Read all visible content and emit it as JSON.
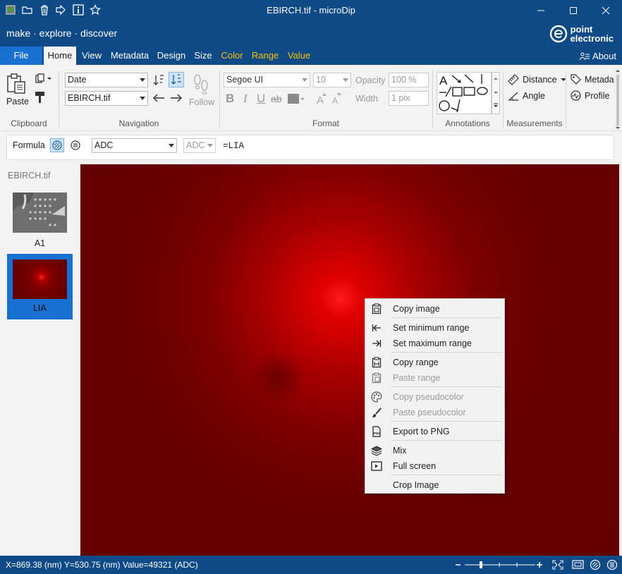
{
  "window": {
    "title": "EBIRCH.tif - microDip",
    "tagline": "make · explore · discover",
    "logo": {
      "line1": "point",
      "line2": "electronic"
    }
  },
  "menu": {
    "file": "File",
    "tabs": [
      "Home",
      "View",
      "Metadata",
      "Design",
      "Size",
      "Color",
      "Range",
      "Value"
    ],
    "about": "About"
  },
  "ribbon": {
    "clipboard": {
      "paste": "Paste",
      "label": "Clipboard"
    },
    "navigation": {
      "sort_select": "Date",
      "file_select": "EBIRCH.tif",
      "follow": "Follow",
      "label": "Navigation"
    },
    "format": {
      "font": "Segoe UI",
      "size": "10",
      "opacity_label": "Opacity",
      "opacity_value": "100 %",
      "width_label": "Width",
      "width_value": "1 pix",
      "bold": "B",
      "italic": "I",
      "underline": "U",
      "strike": "ab",
      "label": "Format"
    },
    "annotations": {
      "label": "Annotations",
      "text_tool": "A"
    },
    "measurements": {
      "distance": "Distance",
      "angle": "Angle",
      "label": "Measurements"
    },
    "extra": {
      "metadata": "Metada",
      "profile": "Profile"
    }
  },
  "formula": {
    "label": "Formula",
    "channel": "ADC",
    "unit": "ADC",
    "expression": "=LIA"
  },
  "panel": {
    "file": "EBIRCH.tif",
    "thumbnails": [
      {
        "label": "A1",
        "selected": false
      },
      {
        "label": "LIA",
        "selected": true
      }
    ]
  },
  "context_menu": {
    "items": [
      {
        "label": "Copy image",
        "icon": "copy-image-icon",
        "enabled": true
      },
      {
        "label": "Set minimum range",
        "icon": "set-min-icon",
        "enabled": true
      },
      {
        "label": "Set maximum range",
        "icon": "set-max-icon",
        "enabled": true
      },
      {
        "label": "Copy range",
        "icon": "copy-range-icon",
        "enabled": true
      },
      {
        "label": "Paste range",
        "icon": "paste-range-icon",
        "enabled": false
      },
      {
        "label": "Copy pseudocolor",
        "icon": "palette-icon",
        "enabled": false
      },
      {
        "label": "Paste pseudocolor",
        "icon": "brush-icon",
        "enabled": false
      },
      {
        "label": "Export to PNG",
        "icon": "png-file-icon",
        "enabled": true
      },
      {
        "label": "Mix",
        "icon": "layers-icon",
        "enabled": true
      },
      {
        "label": "Full screen",
        "icon": "fullscreen-icon",
        "enabled": true
      },
      {
        "label": "Crop Image",
        "icon": "",
        "enabled": true
      }
    ]
  },
  "status": {
    "text": "X=869.38 (nm)   Y=530.75 (nm)   Value=49321 (ADC)"
  },
  "colors": {
    "accent": "#0e4a86",
    "file_tab": "#1870d0",
    "highlight_tab": "#f5c400",
    "selected_thumb": "#1870d0"
  }
}
